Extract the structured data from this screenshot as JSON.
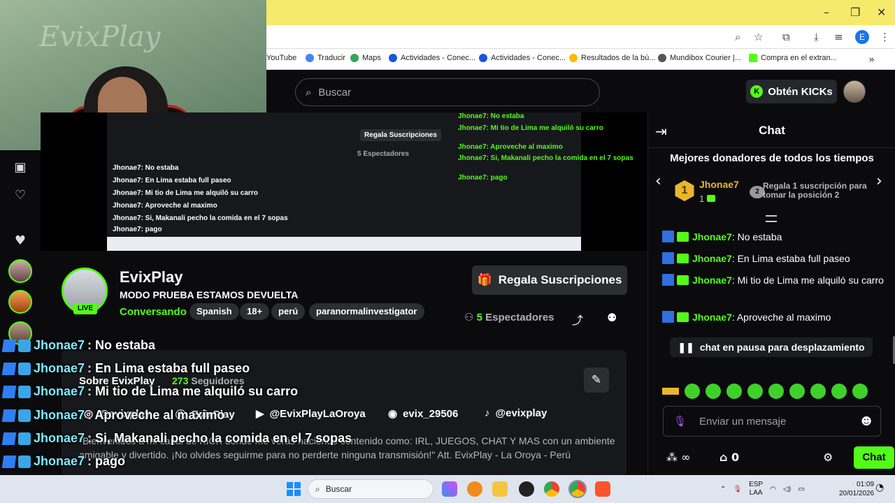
{
  "browser": {
    "bookmarks": [
      {
        "label": "YouTube",
        "color": "#ff0000"
      },
      {
        "label": "Traducir",
        "color": "#4285f4"
      },
      {
        "label": "Maps",
        "color": "#34a853"
      },
      {
        "label": "Actividades - Conec...",
        "color": "#1a56db"
      },
      {
        "label": "Actividades - Conec...",
        "color": "#1a56db"
      },
      {
        "label": "Resultados de la bú...",
        "color": "#fbbc04"
      },
      {
        "label": "Mundibox Courier |...",
        "color": "#555555"
      },
      {
        "label": "Compra en el extran...",
        "color": "#53fc18"
      }
    ],
    "profile_initial": "E"
  },
  "header": {
    "search_placeholder": "Buscar",
    "get_kicks": "Obtén KICKs",
    "kick_logo": "K"
  },
  "webcam": {
    "overlay_logo": "EvixPlay"
  },
  "video_preview": {
    "lines": [
      "Jhonae7: No estaba",
      "Jhonae7: En Lima estaba full paseo",
      "Jhonae7: Mi tio de Lima me alquiló su carro",
      "Jhonae7: Aproveche al maximo",
      "Jhonae7: Si, Makanali pecho la comida en el 7 sopas",
      "Jhonae7: pago"
    ],
    "gift_button": "Regala Suscripciones",
    "viewers": "5 Espectadores"
  },
  "stream": {
    "streamer": "EvixPlay",
    "title": "MODO PRUEBA ESTAMOS DEVUELTA",
    "live": "LIVE",
    "category": "Conversando",
    "tags": [
      "Spanish",
      "18+",
      "perú",
      "paranormalinvestigator"
    ],
    "gift_subs": "Regala Suscripciones",
    "viewers_count": "5",
    "viewers_label": "Espectadores",
    "about_title": "Sobre EvixPlay",
    "followers_count": "273",
    "followers_label": "Seguidores",
    "socials": [
      {
        "icon": "instagram-icon",
        "label": "@evixplay"
      },
      {
        "icon": "facebook-icon",
        "label": "EvixPlay"
      },
      {
        "icon": "youtube-icon",
        "label": "@EvixPlayLaOroya"
      },
      {
        "icon": "discord-icon",
        "label": "evix_29506"
      },
      {
        "icon": "tiktok-icon",
        "label": "@evixplay"
      }
    ],
    "bio": "\"Bienvenidos a mi canal de KICK donde me verás haciendo contenido como: IRL, JUEGOS, CHAT Y MAS con un ambiente amigable y divertido. ¡No olvides seguirme para no perderte ninguna transmisión!\" Att. EvixPlay - La Oroya - Perú"
  },
  "overlay_chat": [
    {
      "user": "Jhonae7",
      "text": ": No estaba"
    },
    {
      "user": "Jhonae7",
      "text": ": En Lima estaba full paseo"
    },
    {
      "user": "Jhonae7",
      "text": ": Mi tio de Lima me alquiló su carro"
    },
    {
      "user": "Jhonae7",
      "text": ": Aproveche al maximo"
    },
    {
      "user": "Jhonae7",
      "text": ": Si, Makanali pecho la comida en el 7 sopas"
    },
    {
      "user": "Jhonae7",
      "text": ": pago"
    }
  ],
  "chat": {
    "title": "Chat",
    "donors_title": "Mejores donadores de todos los tiempos",
    "top_donor": {
      "rank": "1",
      "name": "Jhonae7",
      "count": "1"
    },
    "slot_rank": "2",
    "slot_hint": "Regala 1 suscripción para tomar la posición 2",
    "messages": [
      {
        "user": "Jhonae7",
        "text": "No estaba"
      },
      {
        "user": "Jhonae7",
        "text": "En Lima estaba full paseo"
      },
      {
        "user": "Jhonae7",
        "text": "Mi tio de Lima me alquiló su carro"
      },
      {
        "user": "Jhonae7",
        "text": "Aproveche al maximo"
      }
    ],
    "paused": "chat en pausa para desplazamiento",
    "input_placeholder": "Enviar un mensaje",
    "kicks_balance": "0",
    "infinity": "∞",
    "send": "Chat"
  },
  "taskbar": {
    "search": "Buscar",
    "lang_line1": "ESP",
    "lang_line2": "LAA",
    "time": "01:09",
    "date": "20/01/2026"
  },
  "colors": {
    "kick_green": "#53fc18",
    "donor_gold": "#e9b62c",
    "titlebar": "#f5ea6b"
  }
}
